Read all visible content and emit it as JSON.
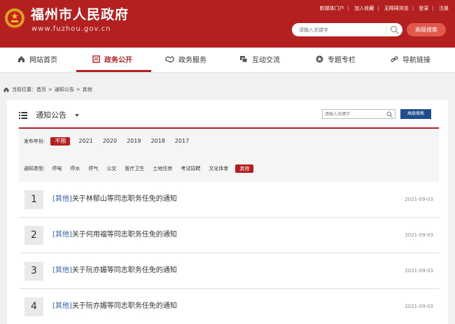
{
  "header": {
    "site_title": "福州市人民政府",
    "site_domain": "www.fuzhou.gov.cn",
    "top_links": [
      "新媒体门户",
      "加入收藏",
      "无障碍浏览",
      "登录",
      "注册"
    ],
    "search_placeholder": "请输入关键字",
    "advanced_search_label": "高级搜索",
    "brand_color": "#b3201f"
  },
  "nav": {
    "items": [
      {
        "label": "网站首页",
        "icon": "home-icon"
      },
      {
        "label": "政务公开",
        "icon": "doc-icon",
        "active": true
      },
      {
        "label": "政务服务",
        "icon": "handshake-icon"
      },
      {
        "label": "互动交流",
        "icon": "chat-icon"
      },
      {
        "label": "专题专栏",
        "icon": "star-icon"
      },
      {
        "label": "导航链接",
        "icon": "link-icon"
      }
    ]
  },
  "breadcrumb": {
    "prefix": "当前位置：",
    "items": [
      "首页",
      "通知公告",
      "其他"
    ]
  },
  "panel": {
    "title": "通知公告",
    "search_placeholder": "请输入关键字",
    "advanced_search_label": "高级搜索"
  },
  "filters": {
    "year_label": "发布年份:",
    "years": [
      "不限",
      "2021",
      "2020",
      "2019",
      "2018",
      "2017"
    ],
    "selected_year": "不限",
    "type_label": "通知类型:",
    "types": [
      "停电",
      "停水",
      "停气",
      "公交",
      "医疗卫生",
      "土地住房",
      "考试招聘",
      "文化体育",
      "其他"
    ],
    "selected_type": "其他"
  },
  "list": [
    {
      "num": "1",
      "tag": "[其他]",
      "title": "关于林郁山等同志职务任免的通知",
      "date": "2021-09-03"
    },
    {
      "num": "2",
      "tag": "[其他]",
      "title": "关于何用福等同志职务任免的通知",
      "date": "2021-09-03"
    },
    {
      "num": "3",
      "tag": "[其他]",
      "title": "关于阮亦媚等同志职务任免的通知",
      "date": "2021-09-03"
    },
    {
      "num": "4",
      "tag": "[其他]",
      "title": "关于阮亦媚等同志职务任免的通知",
      "date": "2021-09-03"
    }
  ]
}
